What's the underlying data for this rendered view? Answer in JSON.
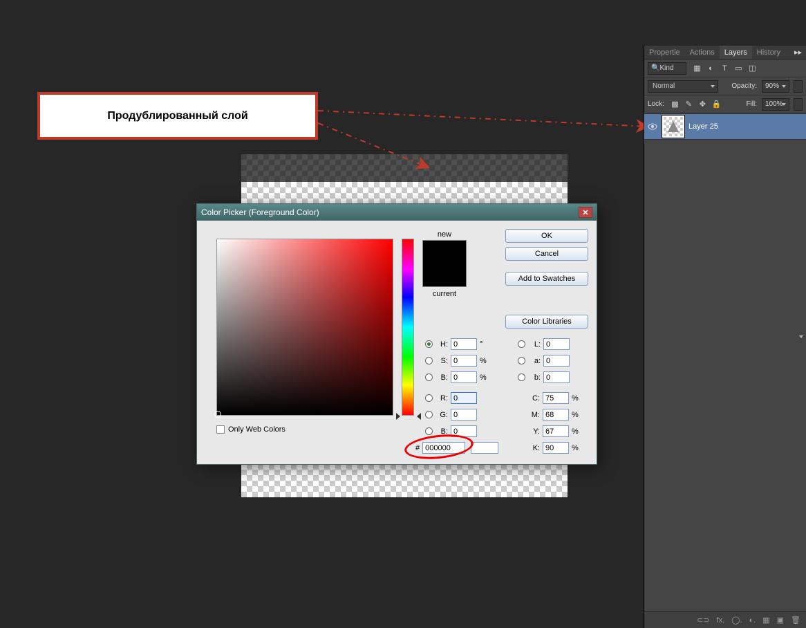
{
  "callout": {
    "text": "Продублированный слой"
  },
  "panel": {
    "tabs": {
      "properties": "Propertie",
      "actions": "Actions",
      "layers": "Layers",
      "history": "History"
    },
    "kind_label": "Kind",
    "blend_mode": "Normal",
    "opacity_label": "Opacity:",
    "opacity_value": "90%",
    "lock_label": "Lock:",
    "fill_label": "Fill:",
    "fill_value": "100%",
    "layer_name": "Layer 25",
    "footer": {
      "link": "⊂⊃",
      "fx": "fx.",
      "mask": "◯.",
      "adj": "◐.",
      "folder": "▦",
      "new": "▣",
      "trash": "🗑"
    }
  },
  "dialog": {
    "title": "Color Picker (Foreground Color)",
    "new_label": "new",
    "current_label": "current",
    "ok": "OK",
    "cancel": "Cancel",
    "add_swatches": "Add to Swatches",
    "color_libraries": "Color Libraries",
    "only_web": "Only Web Colors",
    "hsb": {
      "h_label": "H:",
      "h": "0",
      "h_unit": "°",
      "s_label": "S:",
      "s": "0",
      "s_unit": "%",
      "b_label": "B:",
      "b": "0",
      "b_unit": "%"
    },
    "lab": {
      "l_label": "L:",
      "l": "0",
      "a_label": "a:",
      "a": "0",
      "bb_label": "b:",
      "bb": "0"
    },
    "rgb": {
      "r_label": "R:",
      "r": "0",
      "g_label": "G:",
      "g": "0",
      "b_label": "B:",
      "b": "0"
    },
    "cmyk": {
      "c_label": "C:",
      "c": "75",
      "m_label": "M:",
      "m": "68",
      "y_label": "Y:",
      "y": "67",
      "k_label": "K:",
      "k": "90",
      "unit": "%"
    },
    "hex_symbol": "#",
    "hex": "000000"
  }
}
